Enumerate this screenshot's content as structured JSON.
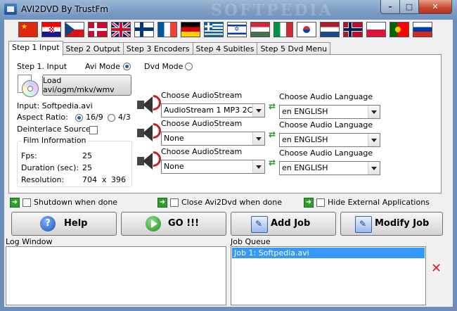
{
  "window": {
    "title": "AVI2DVD By TrustFm",
    "watermark": "SOFTPEDIA",
    "minimize": "–",
    "maximize": "□",
    "close": "✕"
  },
  "flags": [
    "china",
    "croatia",
    "czech",
    "denmark",
    "uk",
    "finland",
    "france",
    "germany",
    "greece",
    "israel",
    "hungary",
    "italy",
    "korea",
    "netherlands",
    "norway",
    "poland",
    "portugal",
    "russia"
  ],
  "tabs": [
    "Step 1 Input",
    "Step 2 Output",
    "Step 3 Encoders",
    "Step 4 Subitles",
    "Step 5 Dvd Menu"
  ],
  "step1": {
    "section_label": "Step 1. Input",
    "avi_mode": "Avi Mode",
    "dvd_mode": "Dvd Mode",
    "load_button": "Load avi/ogm/mkv/wmv",
    "input_file": "Input: Softpedia.avi",
    "aspect_label": "Aspect Ratio:",
    "aspect_169": "16/9",
    "aspect_43": "4/3",
    "deinterlace": "Deinterlace Source:",
    "film_info_title": "Film Information",
    "fps_label": "Fps:",
    "fps_value": "25",
    "duration_label": "Duration (sec):",
    "duration_value": "25",
    "resolution_label": "Resolution:",
    "res_w": "704",
    "res_x": "x",
    "res_h": "396"
  },
  "audio_streams": [
    {
      "stream_label": "Choose AudioStream",
      "stream_value": "AudioStream 1 MP3 2CH",
      "lang_label": "Choose Audio Language",
      "lang_value": "en ENGLISH"
    },
    {
      "stream_label": "Choose AudioStream",
      "stream_value": "None",
      "lang_label": "Choose Audio Language",
      "lang_value": "en ENGLISH"
    },
    {
      "stream_label": "Choose AudioStream",
      "stream_value": "None",
      "lang_label": "Choose Audio Language",
      "lang_value": "en ENGLISH"
    }
  ],
  "options": {
    "shutdown": "Shutdown when done",
    "close_app": "Close Avi2Dvd when done",
    "hide_external": "Hide External Applications"
  },
  "buttons": {
    "help": "Help",
    "go": "GO !!!",
    "add_job": "Add Job",
    "modify_job": "Modify Job"
  },
  "log": {
    "label": "Log Window"
  },
  "queue": {
    "label": "Job Queue",
    "items": [
      "Job 1: Softpedia.avi"
    ]
  },
  "colors": {
    "accent": "#3399ff",
    "title_bar": "#7c9dc4",
    "close": "#c7452d"
  }
}
